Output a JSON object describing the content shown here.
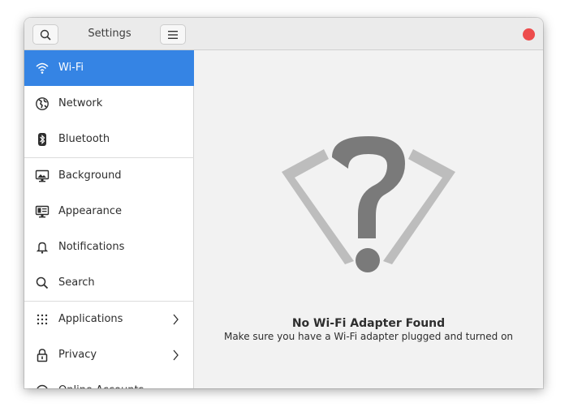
{
  "window": {
    "title": "Settings"
  },
  "sidebar": {
    "items": [
      {
        "label": "Wi-Fi",
        "icon": "wifi-icon",
        "active": true
      },
      {
        "label": "Network",
        "icon": "globe-icon"
      },
      {
        "label": "Bluetooth",
        "icon": "bluetooth-icon"
      },
      {
        "label": "Background",
        "icon": "monitor-icon"
      },
      {
        "label": "Appearance",
        "icon": "appearance-icon"
      },
      {
        "label": "Notifications",
        "icon": "bell-icon"
      },
      {
        "label": "Search",
        "icon": "search-icon"
      },
      {
        "label": "Applications",
        "icon": "app-grid-icon",
        "has_submenu": true
      },
      {
        "label": "Privacy",
        "icon": "lock-icon",
        "has_submenu": true
      },
      {
        "label": "Online Accounts",
        "icon": "online-accounts-icon"
      }
    ]
  },
  "content": {
    "title": "No Wi-Fi Adapter Found",
    "subtitle": "Make sure you have a Wi-Fi adapter plugged and turned on",
    "illustration_icon": "wifi-unknown-icon"
  },
  "colors": {
    "accent": "#3584e4",
    "close": "#ed4c4c"
  }
}
